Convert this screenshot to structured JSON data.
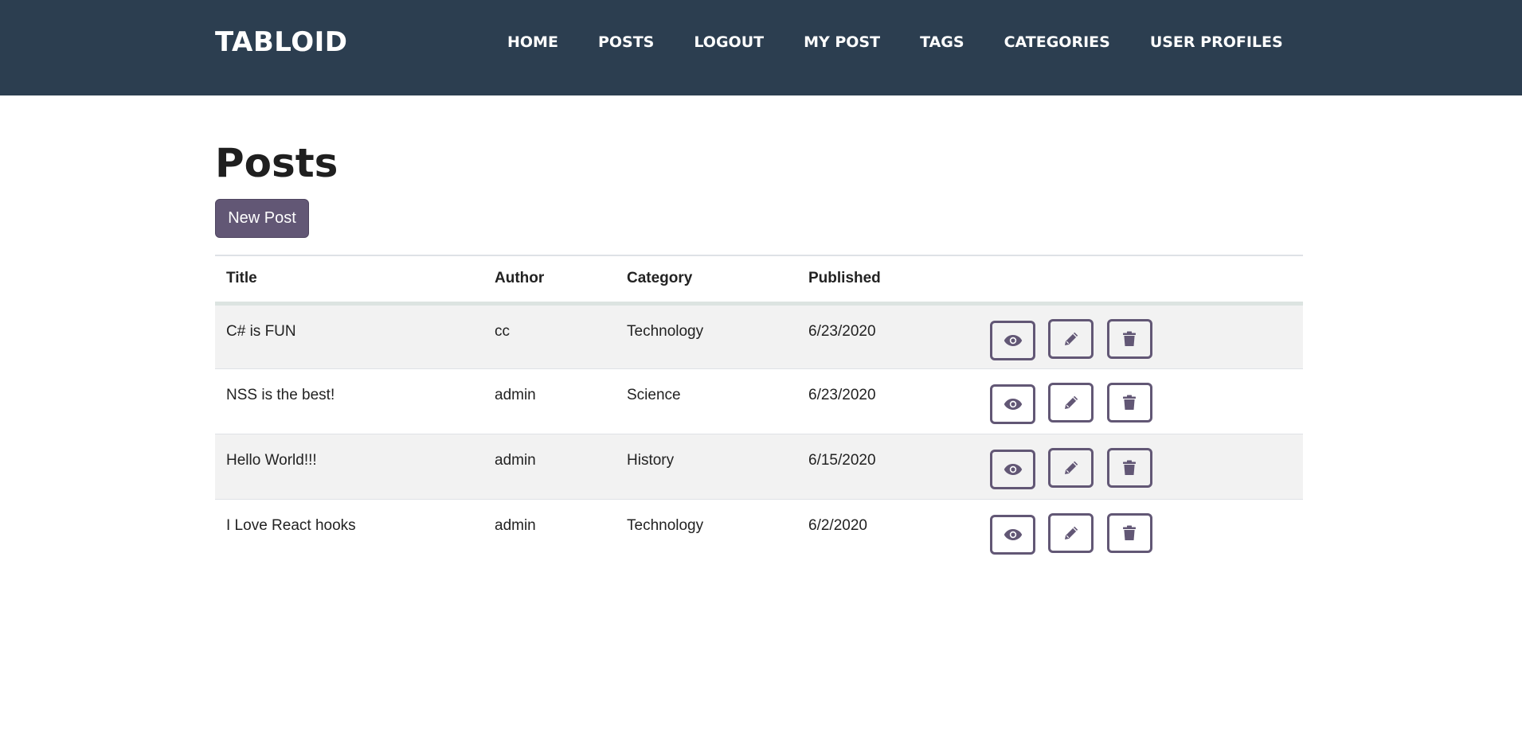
{
  "navbar": {
    "brand": "TABLOID",
    "links": [
      {
        "label": "HOME"
      },
      {
        "label": "POSTS"
      },
      {
        "label": "LOGOUT"
      },
      {
        "label": "MY POST"
      },
      {
        "label": "TAGS"
      },
      {
        "label": "CATEGORIES"
      },
      {
        "label": "USER PROFILES"
      }
    ]
  },
  "page": {
    "title": "Posts",
    "new_post_label": "New Post"
  },
  "table": {
    "columns": [
      "Title",
      "Author",
      "Category",
      "Published"
    ],
    "rows": [
      {
        "title": "C# is FUN",
        "author": "cc",
        "category": "Technology",
        "published": "6/23/2020"
      },
      {
        "title": "NSS is the best!",
        "author": "admin",
        "category": "Science",
        "published": "6/23/2020"
      },
      {
        "title": "Hello World!!!",
        "author": "admin",
        "category": "History",
        "published": "6/15/2020"
      },
      {
        "title": "I Love React hooks",
        "author": "admin",
        "category": "Technology",
        "published": "6/2/2020"
      }
    ],
    "row_actions": [
      "eye-icon",
      "pencil-icon",
      "trash-icon"
    ]
  },
  "colors": {
    "navbar_bg": "#2c3e50",
    "accent": "#625775",
    "stripe": "#f2f2f2"
  }
}
